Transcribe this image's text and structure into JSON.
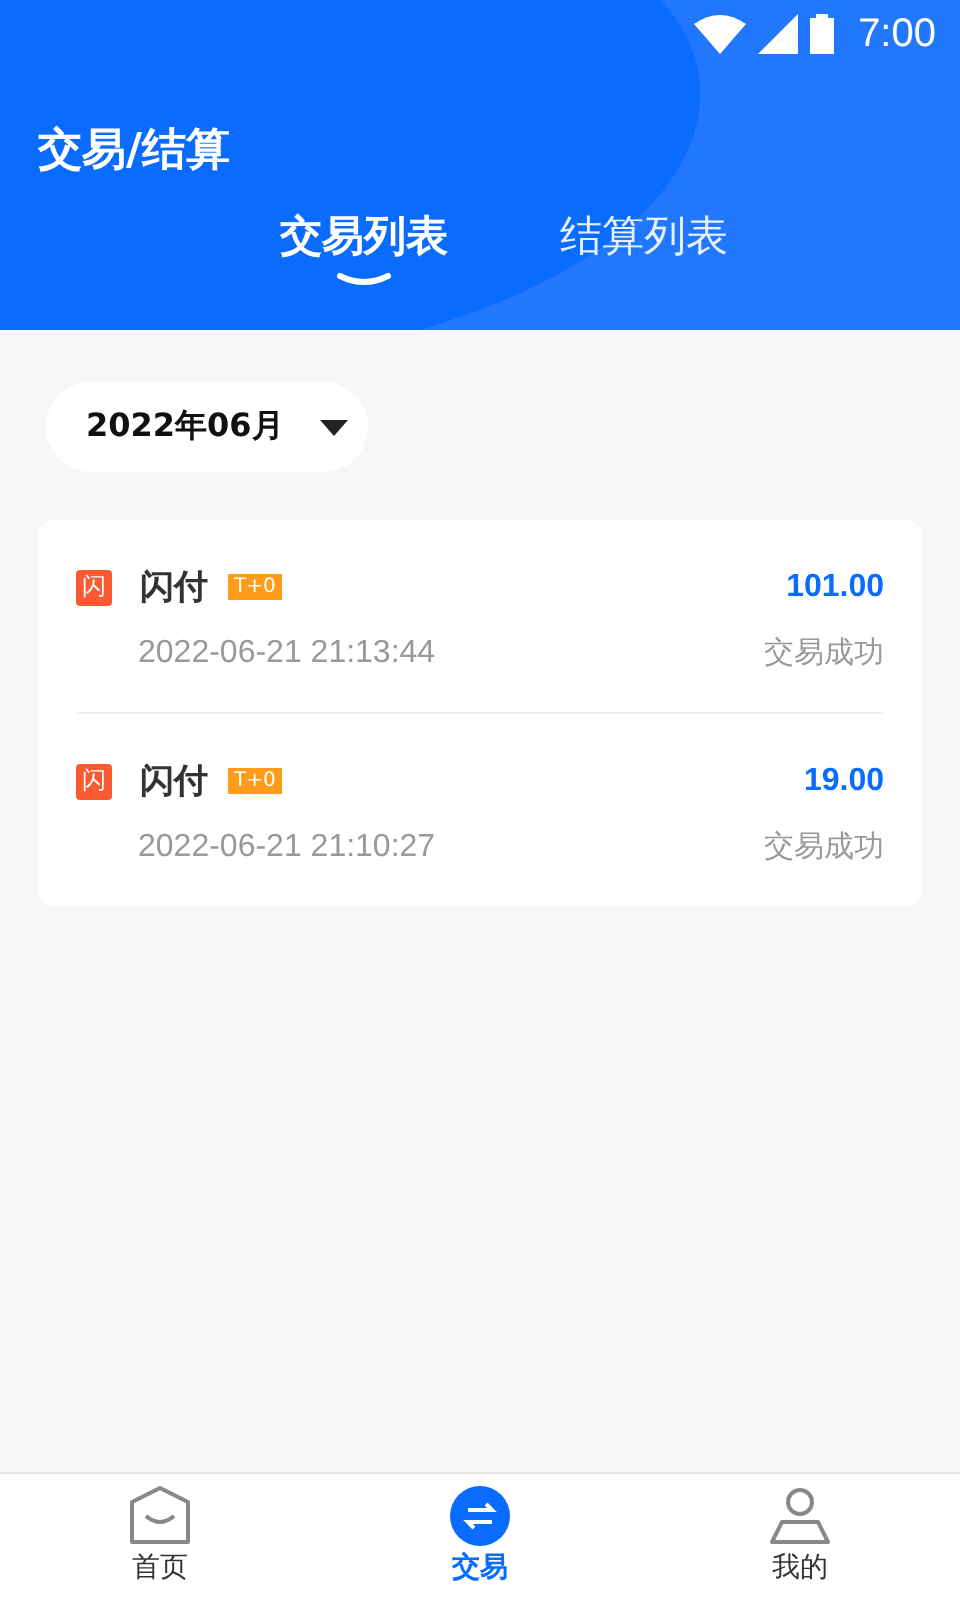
{
  "status_bar": {
    "time": "7:00"
  },
  "header": {
    "title": "交易/结算"
  },
  "tabs": [
    {
      "label": "交易列表",
      "selected": true
    },
    {
      "label": "结算列表",
      "selected": false
    }
  ],
  "month_picker": {
    "value": "2022年06月"
  },
  "transactions": [
    {
      "icon_char": "闪",
      "name": "闪付",
      "tag": "T+0",
      "amount": "101.00",
      "time": "2022-06-21 21:13:44",
      "status": "交易成功"
    },
    {
      "icon_char": "闪",
      "name": "闪付",
      "tag": "T+0",
      "amount": "19.00",
      "time": "2022-06-21 21:10:27",
      "status": "交易成功"
    }
  ],
  "bottom_nav": [
    {
      "kind": "home",
      "label": "首页",
      "selected": false
    },
    {
      "kind": "trade",
      "label": "交易",
      "selected": true
    },
    {
      "kind": "profile",
      "label": "我的",
      "selected": false
    }
  ]
}
